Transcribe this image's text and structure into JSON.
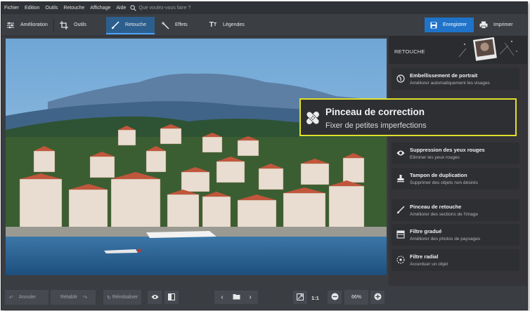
{
  "menu": {
    "items": [
      "Fichier",
      "Edition",
      "Outils",
      "Retouche",
      "Affichage",
      "Aide"
    ],
    "search_placeholder": "Que voulez-vous faire ?"
  },
  "toolbar": {
    "tabs": [
      "Amélioration",
      "Outils",
      "Retouche",
      "Effets",
      "Légendes"
    ],
    "active_tab": "Retouche",
    "save_label": "Enregistrer",
    "print_label": "Imprimer"
  },
  "bottom": {
    "undo": "Annuler",
    "redo": "Rétablir",
    "reset": "Réinitialiser",
    "ratio": "1:1",
    "zoom": "66%"
  },
  "panel": {
    "title": "RETOUCHE",
    "tools": [
      {
        "title": "Embellissement de portrait",
        "subtitle": "Améliorer automatiquement les visages",
        "icon": "portrait-icon"
      },
      {
        "title": "Pinceau de correction",
        "subtitle": "Fixer de petites imperfections",
        "icon": "bandage-icon"
      },
      {
        "title": "Suppression des yeux rouges",
        "subtitle": "Eliminer les yeux rouges",
        "icon": "eye-icon"
      },
      {
        "title": "Tampon de duplication",
        "subtitle": "Supprimer des objets non désirés",
        "icon": "stamp-icon"
      },
      {
        "title": "Pinceau de retouche",
        "subtitle": "Améliorer des sections de l'image",
        "icon": "brush-icon"
      },
      {
        "title": "Filtre gradué",
        "subtitle": "Améliorer des photos de paysages",
        "icon": "gradient-icon"
      },
      {
        "title": "Filtre radial",
        "subtitle": "Accentuer un objet",
        "icon": "radial-icon"
      }
    ]
  },
  "colors": {
    "accent": "#1f73c9",
    "highlight_border": "#dfe02a",
    "active_tab": "#2c5e8e"
  }
}
